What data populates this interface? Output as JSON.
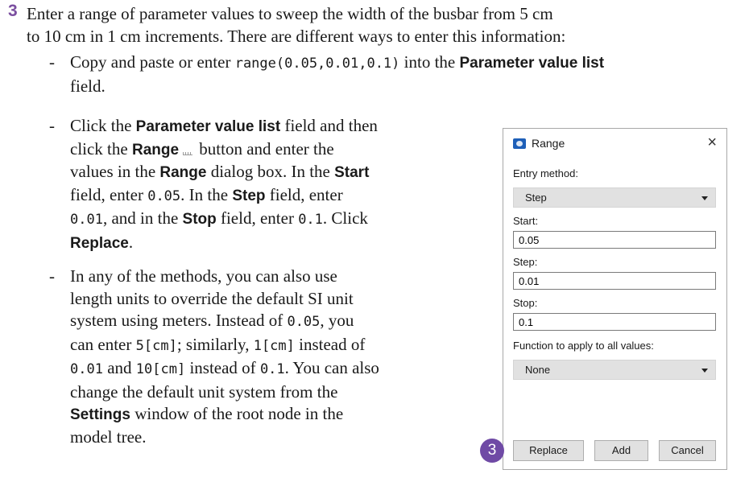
{
  "step": {
    "number": "3",
    "intro_line1": "Enter a range of parameter values to sweep the width of the busbar from 5 cm",
    "intro_line2": "to 10 cm in 1 cm increments. There are different ways to enter this information:"
  },
  "bullets": [
    {
      "marker": "-",
      "t1": "Copy and paste or enter ",
      "code1": "range(0.05,0.01,0.1)",
      "t2": " into the ",
      "ui1": "Parameter value list",
      "t3": "field."
    },
    {
      "marker": "-",
      "l1a": "Click the ",
      "l1ui": "Parameter value list",
      "l1b": " field and then",
      "l2a": "click the ",
      "l2ui": "Range",
      "l2b": " button and enter the",
      "l3a": "values in the ",
      "l3ui1": "Range",
      "l3b": " dialog box. In the ",
      "l3ui2": "Start",
      "l4a": "field, enter ",
      "l4code": "0.05",
      "l4b": ". In the ",
      "l4ui": "Step",
      "l4c": " field, enter",
      "l5code1": "0.01",
      "l5a": ", and in the ",
      "l5ui": "Stop",
      "l5b": " field, enter ",
      "l5code2": "0.1",
      "l5c": ". Click",
      "l6ui": "Replace",
      "l6a": "."
    },
    {
      "marker": "-",
      "l1": "In any of the methods, you can also use",
      "l2": "length units to override the default SI unit",
      "l3": "system using meters. Instead of ",
      "l3code": "0.05",
      "l3b": ", you",
      "l4": "can enter ",
      "l4code1": "5[cm]",
      "l4b": "; similarly, ",
      "l4code2": "1[cm]",
      "l4c": " instead of",
      "l5code1": "0.01",
      "l5a": " and ",
      "l5code2": "10[cm]",
      "l5b": " instead of ",
      "l5code3": "0.1",
      "l5c": ". You can also",
      "l6": "change the default unit system from the",
      "l7ui": "Settings",
      "l7": " window of the root node in the",
      "l8": "model tree."
    }
  ],
  "dialog": {
    "title": "Range",
    "close_icon": "×",
    "entry_method_label": "Entry method:",
    "entry_method_value": "Step",
    "start_label": "Start:",
    "start_value": "0.05",
    "step_label": "Step:",
    "step_value": "0.01",
    "stop_label": "Stop:",
    "stop_value": "0.1",
    "function_label": "Function to apply to all values:",
    "function_value": "None",
    "replace_button": "Replace",
    "add_button": "Add",
    "cancel_button": "Cancel"
  },
  "callout": {
    "number": "3"
  },
  "colors": {
    "step_number": "#7b4fa0",
    "callout_bg": "#6f4aa5",
    "app_icon": "#1e5fb8"
  },
  "icons": {
    "range_button_icon": "range-icon",
    "dialog_app_icon": "comsol-app-icon"
  }
}
